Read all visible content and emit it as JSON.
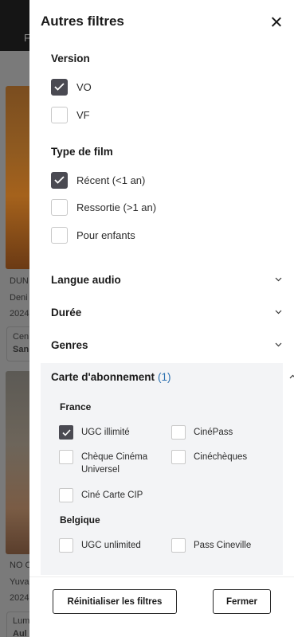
{
  "background": {
    "header_text": "F",
    "movie1_title": "DUN",
    "movie1_meta": "Deni",
    "movie1_year": "2024",
    "movie1_cinema_label": "Cen",
    "movie1_cinema_name": "San",
    "movie2_title": "NO O",
    "movie2_meta": "Yuva",
    "movie2_year": "2024",
    "movie2_cinema_label": "Lum",
    "movie2_cinema_name": "Aul"
  },
  "drawer": {
    "title": "Autres filtres",
    "version": {
      "title": "Version",
      "options": [
        {
          "label": "VO",
          "checked": true
        },
        {
          "label": "VF",
          "checked": false
        }
      ]
    },
    "film_type": {
      "title": "Type de film",
      "options": [
        {
          "label": "Récent (<1 an)",
          "checked": true
        },
        {
          "label": "Ressortie (>1 an)",
          "checked": false
        },
        {
          "label": "Pour enfants",
          "checked": false
        }
      ]
    },
    "accordions": {
      "audio": "Langue audio",
      "duration": "Durée",
      "genres": "Genres",
      "subscription": "Carte d'abonnement",
      "subscription_count": "(1)"
    },
    "subscription": {
      "france_title": "France",
      "belgium_title": "Belgique",
      "ugc_illimite": "UGC illimité",
      "cinepass": "CinéPass",
      "cheque_cinema": "Chèque Cinéma Universel",
      "cinecheques": "Cinéchèques",
      "cine_carte_cip": "Ciné Carte CIP",
      "ugc_unlimited": "UGC unlimited",
      "pass_cineville": "Pass Cineville"
    },
    "footer": {
      "reset_label": "Réinitialiser les filtres",
      "close_label": "Fermer"
    }
  },
  "colors": {
    "checked": "#4a4a52",
    "accent_count": "#2a6fb0",
    "panel_bg": "#f3f4f6"
  }
}
